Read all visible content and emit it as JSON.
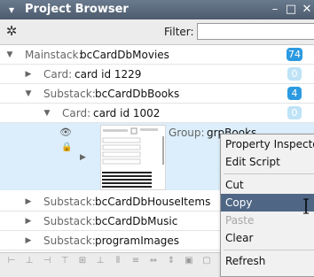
{
  "window": {
    "title": "Project Browser",
    "menu_glyph": "▾",
    "minimize_glyph": "–",
    "maximize_glyph": "□",
    "close_glyph": "✕"
  },
  "toolbar": {
    "settings_glyph": "✲",
    "filter_label": "Filter:",
    "filter_value": ""
  },
  "tree": {
    "rows": [
      {
        "kind": "Mainstack:",
        "name": "bcCardDbMovies",
        "count": "74"
      },
      {
        "kind": "Card:",
        "name": "card id 1229",
        "count": "0"
      },
      {
        "kind": "Substack:",
        "name": "bcCardDbBooks",
        "count": "4"
      },
      {
        "kind": "Card:",
        "name": "card id 1002",
        "count": "0"
      },
      {
        "kind": "Substack:",
        "name": "bcCardDbHouseItems",
        "count": ""
      },
      {
        "kind": "Substack:",
        "name": "bcCardDbMusic",
        "count": ""
      },
      {
        "kind": "Substack:",
        "name": "programImages",
        "count": ""
      }
    ],
    "group": {
      "kind": "Group:",
      "name": "grpBooks"
    }
  },
  "context_menu": {
    "items": [
      {
        "label": "Property Inspector"
      },
      {
        "label": "Edit Script"
      },
      {
        "label": "Cut"
      },
      {
        "label": "Copy"
      },
      {
        "label": "Paste"
      },
      {
        "label": "Clear"
      },
      {
        "label": "Refresh"
      }
    ]
  },
  "colors": {
    "titlebar": "#56657a",
    "selection": "#dceefb",
    "badge_active": "#2c9ae0",
    "badge_empty": "#bfe3f6",
    "menu_highlight": "#4f6785"
  }
}
